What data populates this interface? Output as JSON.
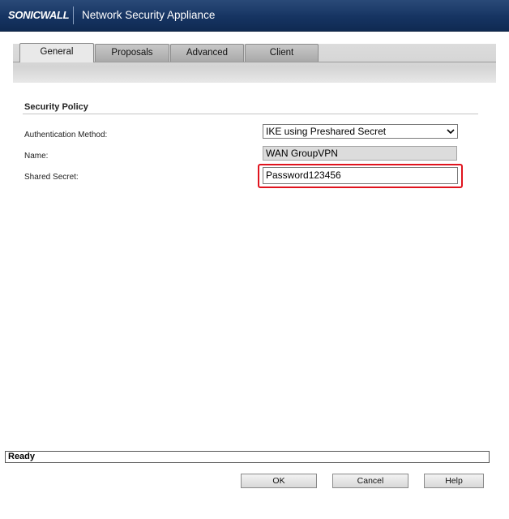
{
  "header": {
    "logo": "SONICWALL",
    "title": "Network Security Appliance"
  },
  "tabs": [
    {
      "label": "General",
      "active": true
    },
    {
      "label": "Proposals",
      "active": false
    },
    {
      "label": "Advanced",
      "active": false
    },
    {
      "label": "Client",
      "active": false
    }
  ],
  "section": {
    "title": "Security Policy"
  },
  "form": {
    "auth_method_label": "Authentication Method:",
    "auth_method_value": "IKE using Preshared Secret",
    "name_label": "Name:",
    "name_value": "WAN GroupVPN",
    "shared_secret_label": "Shared Secret:",
    "shared_secret_value": "Password123456"
  },
  "status": {
    "text": "Ready"
  },
  "buttons": {
    "ok": "OK",
    "cancel": "Cancel",
    "help": "Help"
  },
  "colors": {
    "header_bg": "#163462",
    "highlight": "#e0141e"
  }
}
